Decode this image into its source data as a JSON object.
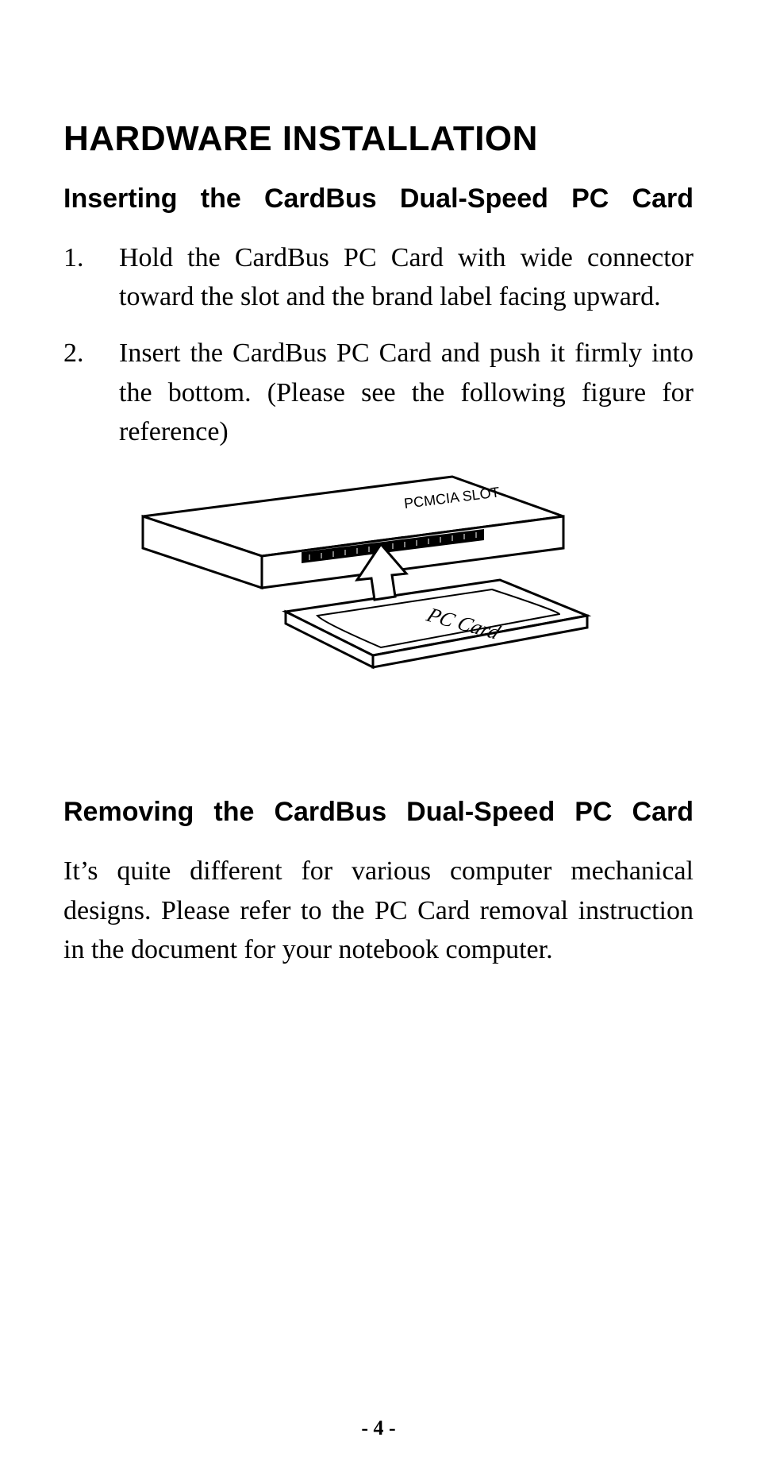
{
  "heading": "HARDWARE INSTALLATION",
  "section1": {
    "title": "Inserting the CardBus Dual-Speed PC Card",
    "steps": [
      {
        "num": "1.",
        "text": "Hold the CardBus PC Card with wide connector toward the slot and the brand label facing upward."
      },
      {
        "num": "2.",
        "text": "Insert the CardBus PC Card and push it firmly into the  bottom.  (Please see the following figure for reference)"
      }
    ]
  },
  "figure": {
    "slot_label": "PCMCIA SLOT",
    "card_label": "PC Card"
  },
  "section2": {
    "title": "Removing the CardBus Dual-Speed PC Card",
    "body": "It’s quite different for various computer mechanical designs. Please refer to the PC Card removal instruction in the document for your notebook computer."
  },
  "page_number": "- 4 -"
}
